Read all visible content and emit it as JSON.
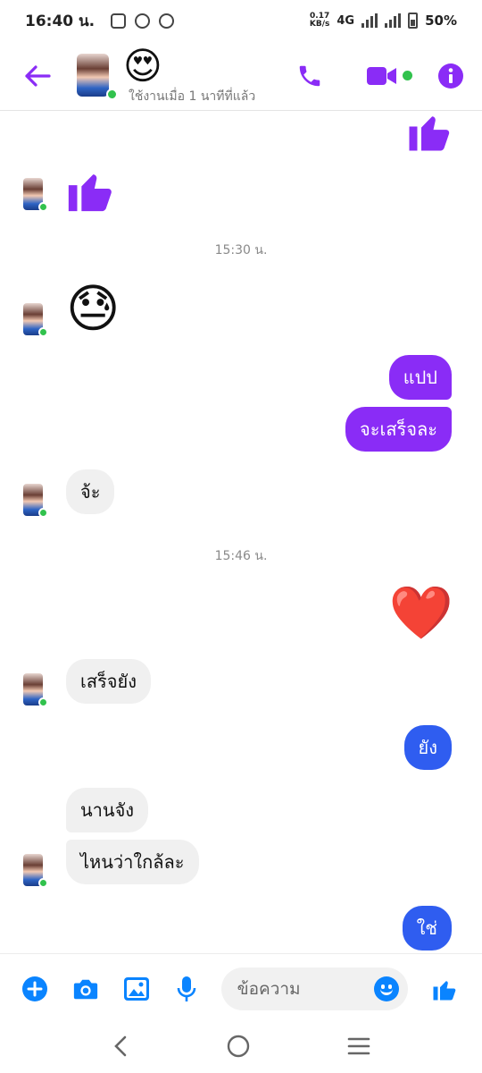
{
  "status_bar": {
    "time": "16:40 น.",
    "net_speed_value": "0.17",
    "net_speed_unit": "KB/s",
    "network": "4G",
    "battery": "50%"
  },
  "header": {
    "name_emoji": "😍",
    "active_status": "ใช้งานเมื่อ 1 นาทีที่แล้ว",
    "accent_color": "#8a2cf6"
  },
  "messages": {
    "thumb_out": "👍",
    "thumb_in": "👍",
    "timestamp_1": "15:30 น.",
    "emoji_in_1": "😓",
    "out_1": "แปป",
    "out_2": "จะเสร็จละ",
    "in_1": "จ้ะ",
    "timestamp_2": "15:46 น.",
    "heart_out": "❤️",
    "in_2": "เสร็จยัง",
    "out_3": "ยัง",
    "in_3": "นานจัง",
    "in_4": "ไหนว่าใกล้ละ",
    "out_4": "ใช่"
  },
  "composer": {
    "placeholder": "ข้อความ"
  },
  "colors": {
    "purple": "#8a2cf6",
    "blue": "#2f5df0",
    "online": "#31c24d",
    "composer_icon": "#0a84ff"
  }
}
